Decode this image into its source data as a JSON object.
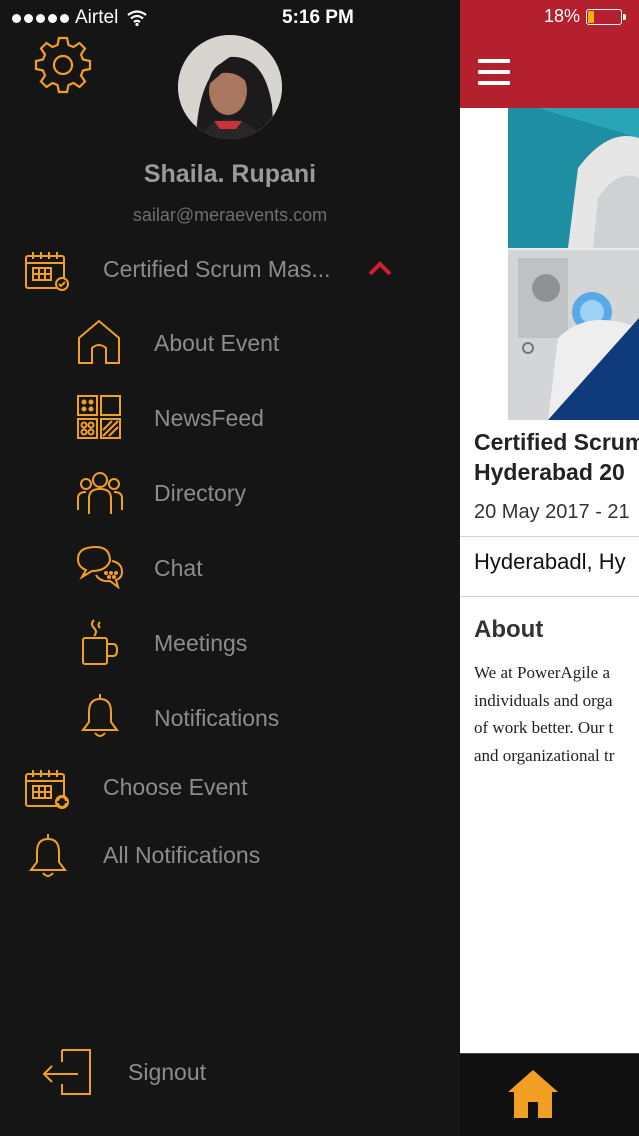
{
  "status_bar": {
    "carrier": "Airtel",
    "time": "5:16 PM",
    "battery": "18%",
    "battery_level": 0.18
  },
  "drawer": {
    "user": {
      "name": "Shaila. Rupani",
      "email": "sailar@meraevents.com"
    },
    "event": {
      "label": "Certified Scrum Mas...",
      "icon": "calendar-check-icon",
      "expanded": true
    },
    "event_items": [
      {
        "label": "About Event",
        "icon": "home-outline-icon"
      },
      {
        "label": "NewsFeed",
        "icon": "grid-icon"
      },
      {
        "label": "Directory",
        "icon": "people-icon"
      },
      {
        "label": "Chat",
        "icon": "chat-bubbles-icon"
      },
      {
        "label": "Meetings",
        "icon": "coffee-cup-icon"
      },
      {
        "label": "Notifications",
        "icon": "bell-icon"
      }
    ],
    "choose_event": "Choose Event",
    "all_notifications": "All Notifications",
    "signout": "Signout",
    "accent_color": "#f2a024",
    "chevron_color": "#d21f2d"
  },
  "main": {
    "event_title_line1": "Certified Scrum",
    "event_title_line2": "Hyderabad 20",
    "event_date": "20 May 2017 - 21",
    "event_location": "Hyderabadl, Hy",
    "about_heading": "About",
    "about_lines": [
      "We at PowerAgile a",
      "individuals and orga",
      "of work better. Our t",
      "and organizational tr"
    ],
    "appbar_color": "#b5202e"
  }
}
